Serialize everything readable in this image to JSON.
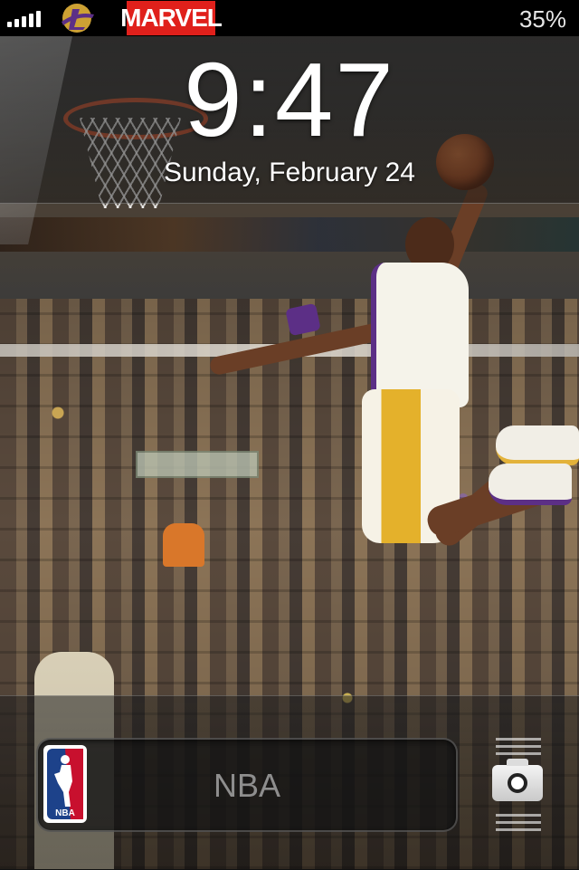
{
  "status_bar": {
    "signal_bars": 5,
    "app_icons": [
      "lakers-logo-icon",
      "marvel-logo-icon"
    ],
    "marvel_text": "MARVEL",
    "battery": "35%"
  },
  "lock_screen": {
    "time": "9:47",
    "date": "Sunday, February 24"
  },
  "unlock_slider": {
    "label": "NBA",
    "knob_icon": "nba-logo-icon",
    "knob_text": "NBA"
  },
  "camera": {
    "icon": "camera-icon"
  },
  "colors": {
    "status_bar_bg": "#000000",
    "lakers_purple": "#5c2f86",
    "lakers_gold": "#e3b23a",
    "marvel_red": "#e0201b",
    "nba_blue": "#1d428a",
    "nba_red": "#c8102e"
  }
}
